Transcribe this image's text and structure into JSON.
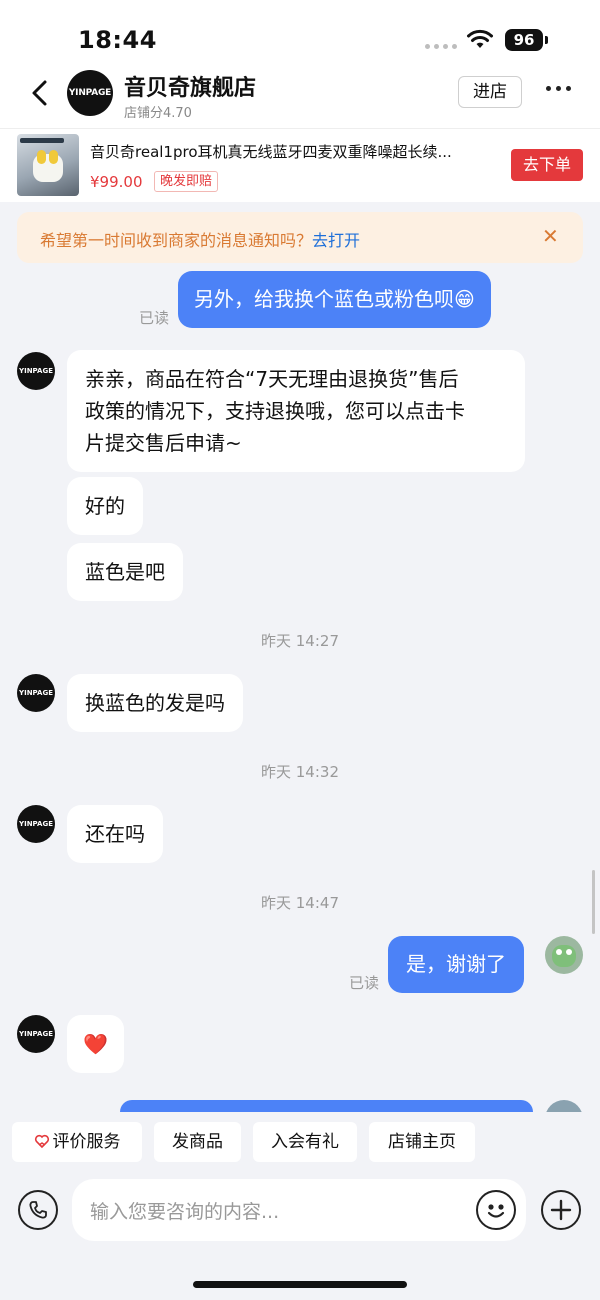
{
  "status_bar": {
    "time": "18:44",
    "battery": "96"
  },
  "header": {
    "shop_logo_text": "YINPAGE",
    "shop_name": "音贝奇旗舰店",
    "shop_score": "店铺分4.70",
    "enter_store": "进店"
  },
  "product": {
    "title": "音贝奇real1pro耳机真无线蓝牙四麦双重降噪超长续...",
    "price": "¥99.00",
    "tag": "晚发即赔",
    "order_button": "去下单"
  },
  "notice": {
    "text": "希望第一时间收到商家的消息通知吗？",
    "link": "去打开"
  },
  "messages": {
    "m1": {
      "text": "另外，给我换个蓝色或粉色呗😁",
      "status": "已读"
    },
    "m2": {
      "line1": "亲亲，商品在符合“7天无理由退换货”售后",
      "line2": "政策的情况下，支持退换哦，您可以点击卡",
      "line3": "片提交售后申请~"
    },
    "m3": {
      "text": "好的"
    },
    "m4": {
      "text": "蓝色是吧"
    },
    "t1": "昨天 14:27",
    "m5": {
      "text": "换蓝色的发是吗"
    },
    "t2": "昨天 14:32",
    "m6": {
      "text": "还在吗"
    },
    "t3": "昨天 14:47",
    "m7": {
      "text": "是，谢谢了",
      "status": "已读"
    },
    "m8": {
      "text": "❤️"
    }
  },
  "quick_actions": [
    "评价服务",
    "发商品",
    "入会有礼",
    "店铺主页"
  ],
  "input": {
    "placeholder": "输入您要咨询的内容..."
  }
}
